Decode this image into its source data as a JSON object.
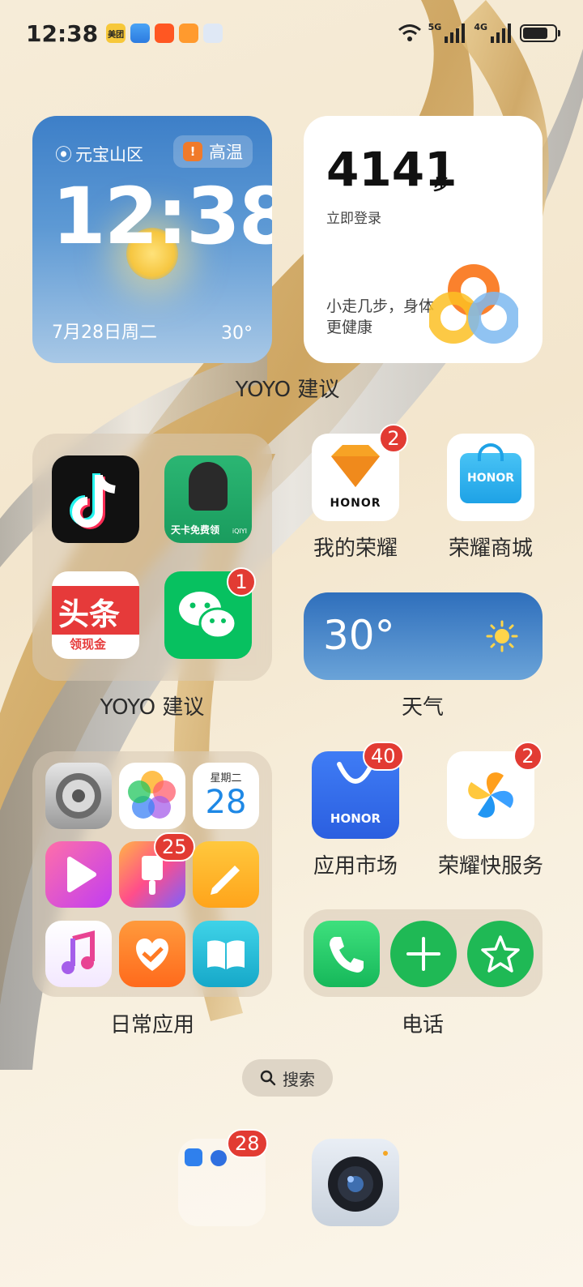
{
  "status_bar": {
    "time": "12:38",
    "network_1": "5G",
    "network_2": "4G",
    "notification_apps": [
      "meituan-icon",
      "weather-mini-icon",
      "kuaishou-icon",
      "ticket-icon",
      "assistant-icon"
    ],
    "notification_app_label": "美团"
  },
  "weather_clock_widget": {
    "location": "元宝山区",
    "alert": "高温",
    "time": "12:38",
    "date": "7月28日周二",
    "temperature": "30°"
  },
  "steps_widget": {
    "steps": "4141",
    "unit": "步",
    "login": "立即登录",
    "tip": "小走几步，身体更健康"
  },
  "labels": {
    "yoyo_1": "YOYO 建议",
    "yoyo_2": "YOYO 建议",
    "weather": "天气",
    "daily_apps": "日常应用",
    "phone": "电话"
  },
  "apps": {
    "my_honor": {
      "label": "我的荣耀",
      "badge": "2",
      "brand": "HONOR"
    },
    "honor_store": {
      "label": "荣耀商城",
      "brand": "HONOR"
    },
    "app_market": {
      "label": "应用市场",
      "badge": "40",
      "brand": "HONOR"
    },
    "honor_quick_service": {
      "label": "荣耀快服务",
      "badge": "2"
    },
    "wechat_badge": "1",
    "editor_badge": "25",
    "dock_folder_badge": "28"
  },
  "yoyo_folder": {
    "iqiyi_caption": "天卡免费领",
    "iqiyi_brand": "iQIYI",
    "toutiao_title": "头条",
    "toutiao_caption": "领现金"
  },
  "calendar_icon": {
    "weekday": "星期二",
    "day": "28"
  },
  "weather_widget_small": {
    "temperature": "30°"
  },
  "search": {
    "label": "搜索"
  },
  "colors": {
    "badge": "#e23b33",
    "accent": "#2b6fd6"
  }
}
